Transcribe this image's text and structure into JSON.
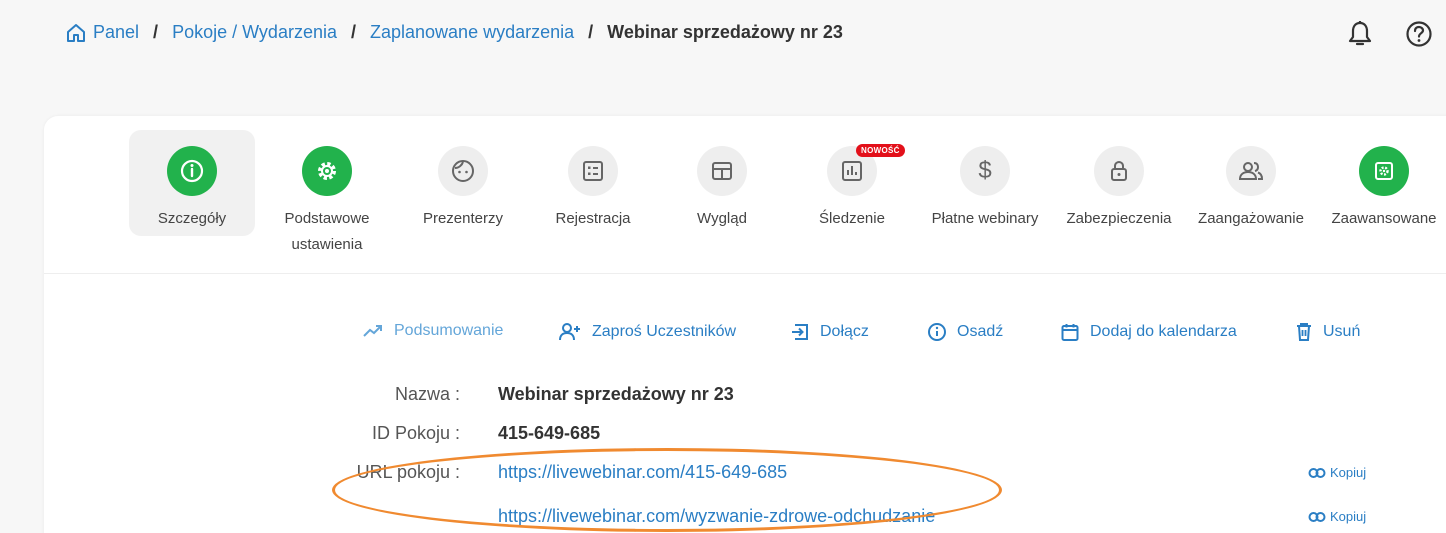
{
  "breadcrumb": {
    "items": [
      "Panel",
      "Pokoje / Wydarzenia",
      "Zaplanowane wydarzenia"
    ],
    "current": "Webinar sprzedażowy nr 23",
    "separator": "/"
  },
  "header_icons": [
    "bell-icon",
    "help-icon"
  ],
  "tabs": [
    {
      "label": "Szczegóły",
      "icon": "info-icon",
      "active": true,
      "color": "#22b24c"
    },
    {
      "label": "Podstawowe ustawienia",
      "icon": "gear-icon",
      "color": "#22b24c"
    },
    {
      "label": "Prezenterzy",
      "icon": "face-icon"
    },
    {
      "label": "Rejestracja",
      "icon": "form-icon"
    },
    {
      "label": "Wygląd",
      "icon": "layout-icon"
    },
    {
      "label": "Śledzenie",
      "icon": "chart-icon",
      "badge": "NOWOŚĆ"
    },
    {
      "label": "Płatne webinary",
      "icon": "dollar-icon"
    },
    {
      "label": "Zabezpieczenia",
      "icon": "lock-icon"
    },
    {
      "label": "Zaangażowanie",
      "icon": "people-icon"
    },
    {
      "label": "Zaawansowane",
      "icon": "advanced-gear-icon",
      "color": "#22b24c"
    }
  ],
  "actions": [
    {
      "label": "Podsumowanie",
      "icon": "trending-up-icon"
    },
    {
      "label": "Zaproś Uczestników",
      "icon": "add-user-icon"
    },
    {
      "label": "Dołącz",
      "icon": "enter-icon"
    },
    {
      "label": "Osadź",
      "icon": "info-icon"
    },
    {
      "label": "Dodaj do kalendarza",
      "icon": "calendar-icon"
    },
    {
      "label": "Usuń",
      "icon": "trash-icon"
    }
  ],
  "details": {
    "name_label": "Nazwa :",
    "name_value": "Webinar sprzedażowy nr 23",
    "id_label": "ID Pokoju :",
    "id_value": "415-649-685",
    "url_label": "URL pokoju :",
    "url_value_1": "https://livewebinar.com/415-649-685",
    "url_value_2": "https://livewebinar.com/wyzwanie-zdrowe-odchudzanie",
    "copy_label": "Kopiuj"
  },
  "colors": {
    "accent": "#2a7ec4",
    "green": "#22b24c",
    "badge": "#e3101a",
    "highlight": "#f08a30"
  }
}
